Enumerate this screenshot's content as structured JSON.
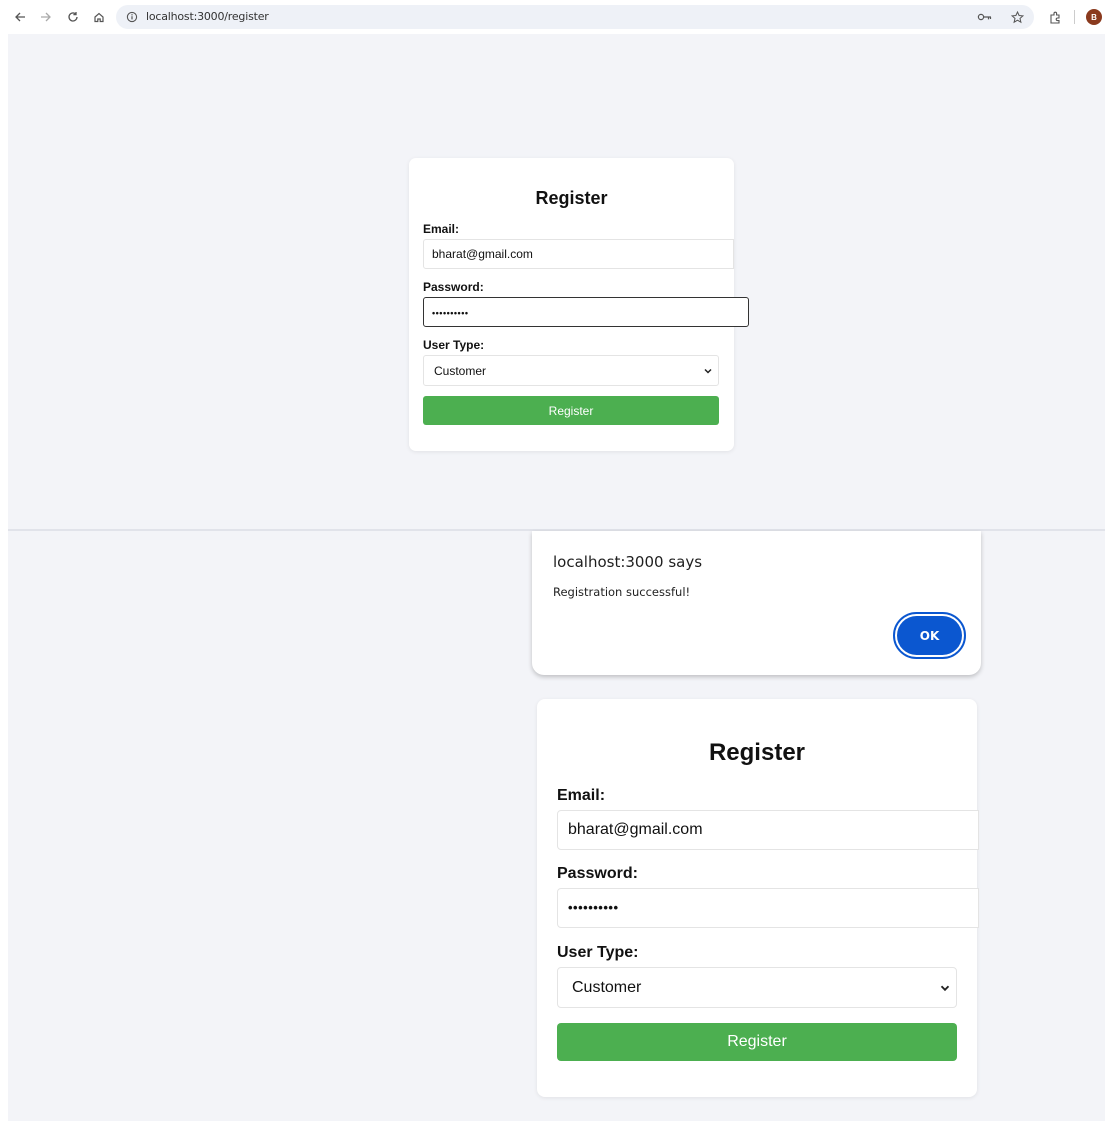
{
  "browser": {
    "url": "localhost:3000/register",
    "nav_icons": [
      "back-icon",
      "forward-icon",
      "reload-icon",
      "home-icon"
    ]
  },
  "form": {
    "title": "Register",
    "email_label": "Email:",
    "email_value": "bharat@gmail.com",
    "password_label": "Password:",
    "password_value": "••••••••••",
    "user_type_label": "User Type:",
    "user_type_value": "Customer",
    "submit_label": "Register"
  },
  "dialog": {
    "title": "localhost:3000 says",
    "message": "Registration successful!",
    "ok_label": "OK"
  },
  "colors": {
    "page_bg": "#f3f4f8",
    "submit_green": "#4caf50",
    "dialog_accent": "#0b57d0"
  }
}
